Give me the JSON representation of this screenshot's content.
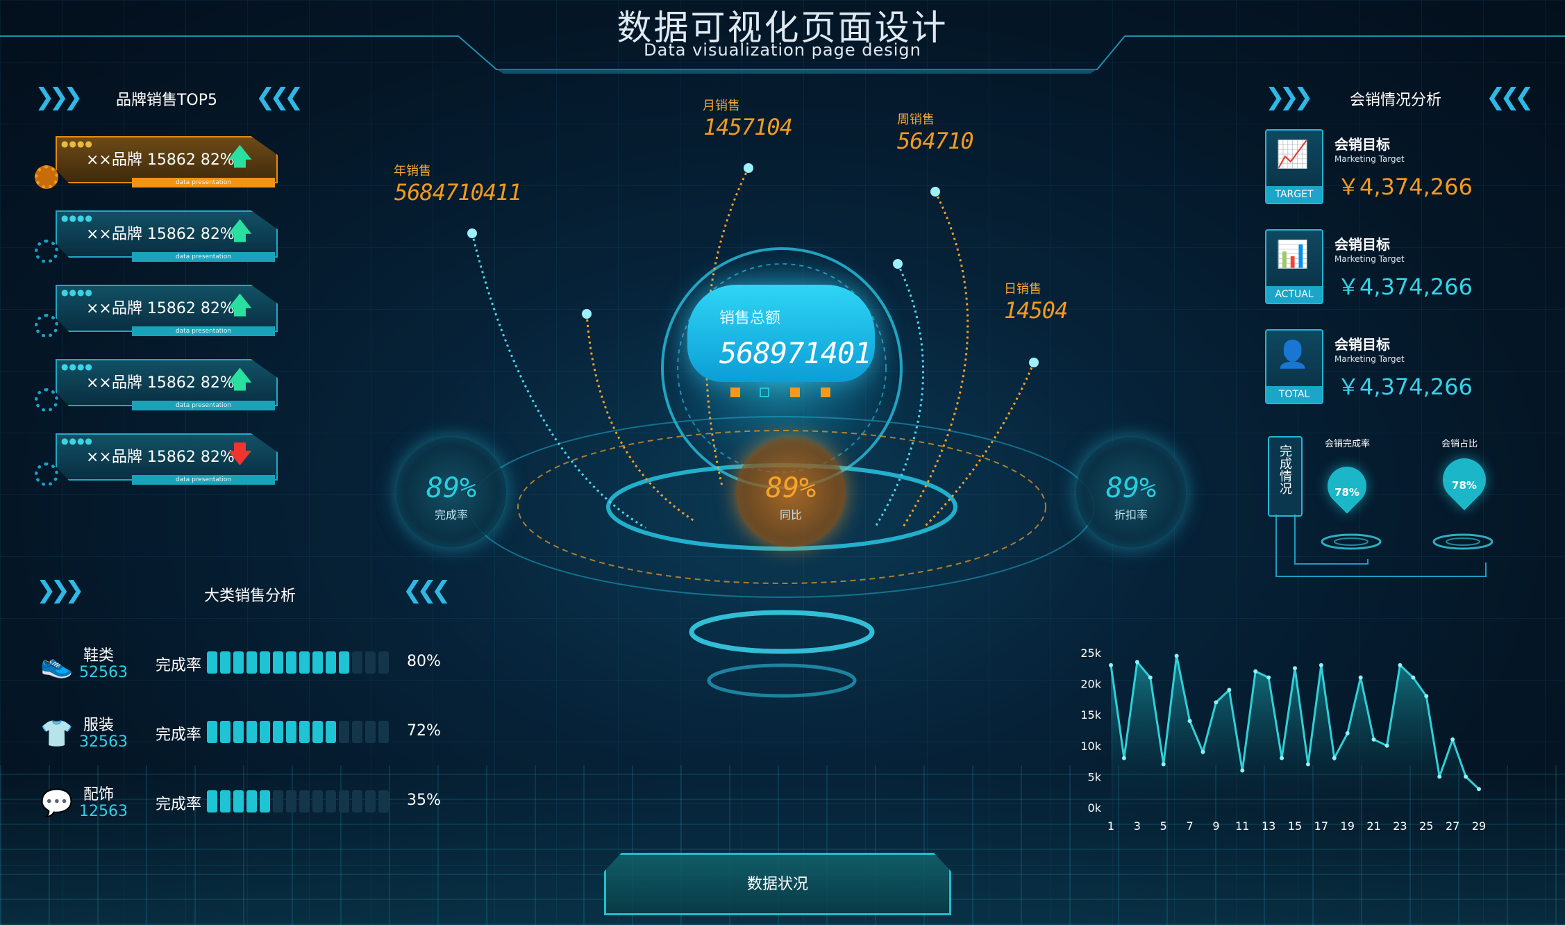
{
  "header": {
    "title_zh": "数据可视化页面设计",
    "title_en": "Data visualization page design"
  },
  "brand_panel": {
    "title": "品牌销售TOP5",
    "items": [
      {
        "label": "××品牌 15862 82%",
        "strip": "data presentation",
        "trend": "up",
        "arrow": "🡅"
      },
      {
        "label": "××品牌 15862 82%",
        "strip": "data presentation",
        "trend": "up",
        "arrow": "🡅"
      },
      {
        "label": "××品牌 15862 82%",
        "strip": "data presentation",
        "trend": "up",
        "arrow": "🡅"
      },
      {
        "label": "××品牌 15862 82%",
        "strip": "data presentation",
        "trend": "up",
        "arrow": "🡅"
      },
      {
        "label": "××品牌 15862 82%",
        "strip": "data presentation",
        "trend": "down",
        "arrow": "🡇"
      }
    ]
  },
  "category_panel": {
    "title": "大类销售分析",
    "rate_label": "完成率",
    "items": [
      {
        "name": "鞋类",
        "value": "52563",
        "pct_text": "80%",
        "fraction": 0.8,
        "icon": "shoe-icon"
      },
      {
        "name": "服装",
        "value": "32563",
        "pct_text": "72%",
        "fraction": 0.72,
        "icon": "shirt-icon"
      },
      {
        "name": "配饰",
        "value": "12563",
        "pct_text": "35%",
        "fraction": 0.35,
        "icon": "accessory-icon"
      }
    ]
  },
  "center": {
    "year_label": "年销售",
    "year_value": "5684710411",
    "month_label": "月销售",
    "month_value": "1457104",
    "week_label": "周销售",
    "week_value": "564710",
    "day_label": "日销售",
    "day_value": "14504",
    "total_label": "销售总额",
    "total_value": "568971401",
    "gauge_left": {
      "value": "89%",
      "label": "完成率"
    },
    "gauge_mid": {
      "value": "89%",
      "label": "同比"
    },
    "gauge_right": {
      "value": "89%",
      "label": "折扣率"
    }
  },
  "right_panel": {
    "title": "会销情况分析",
    "kpis": [
      {
        "title": "会销目标",
        "sub": "Marketing Target",
        "value": "￥4,374,266",
        "tag": "TARGET",
        "color": "#f39a1e"
      },
      {
        "title": "会销目标",
        "sub": "Marketing Target",
        "value": "￥4,374,266",
        "tag": "ACTUAL",
        "color": "#36d3e8"
      },
      {
        "title": "会销目标",
        "sub": "Marketing Target",
        "value": "￥4,374,266",
        "tag": "TOTAL",
        "color": "#36d3e8"
      }
    ],
    "completion_box": "完成情况",
    "drops": [
      {
        "label": "会销完成率",
        "value": "78%"
      },
      {
        "label": "会销占比",
        "value": "78%"
      }
    ]
  },
  "chart_data": {
    "type": "line",
    "title": "",
    "xlabel": "",
    "ylabel": "",
    "y_ticks": [
      "25k",
      "20k",
      "15k",
      "10k",
      "5k",
      "0k"
    ],
    "ylim": [
      0,
      25000
    ],
    "x_ticks": [
      "1",
      "3",
      "5",
      "7",
      "9",
      "11",
      "13",
      "15",
      "17",
      "19",
      "21",
      "23",
      "25",
      "27",
      "29"
    ],
    "series": [
      {
        "x": [
          1,
          2,
          3,
          4,
          5,
          6,
          7,
          8,
          9,
          10,
          11,
          12,
          13,
          14,
          15,
          16,
          17,
          18,
          19,
          20,
          21,
          22,
          23,
          24,
          25,
          26,
          27,
          28,
          29
        ],
        "values": [
          23000,
          8000,
          23500,
          21000,
          7000,
          24500,
          14000,
          9000,
          17000,
          19000,
          6000,
          22000,
          21000,
          8000,
          22500,
          7000,
          23000,
          8000,
          12000,
          21000,
          11000,
          10000,
          23000,
          21000,
          18000,
          5000,
          11000,
          5000,
          3000
        ]
      }
    ],
    "grid": false
  },
  "footer": {
    "tab_label": "数据状况"
  },
  "colors": {
    "accent_cyan": "#1ec3d4",
    "accent_orange": "#f39a1e",
    "up_green": "#29e0a0",
    "down_red": "#f0342f"
  }
}
